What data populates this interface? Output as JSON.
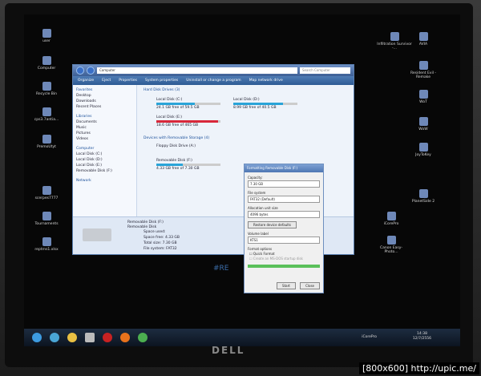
{
  "brand": "DELL",
  "watermark": "[800x600] http://upic.me/",
  "desktop": {
    "left_icons": [
      "user",
      "Computer",
      "Recycle Bin",
      "cps3.7antia...",
      "PremoUtyt",
      "scerpes7777",
      "Tournaments",
      "reptrns1.xlsx"
    ],
    "right_icons": [
      "Infiltration Survivor -...",
      "AVIA",
      "Resident Evil - Remake",
      "WoT",
      "WoW",
      "JoyToKey",
      "PlanetSide 2",
      "share",
      "iCorePro",
      "Data",
      "Canon Easy-Photo..."
    ],
    "overlay_text": "#RE"
  },
  "explorer": {
    "address": "Computer",
    "search_placeholder": "Search Computer",
    "toolbar": [
      "Organize",
      "Eject",
      "Properties",
      "System properties",
      "Uninstall or change a program",
      "Map network drive"
    ],
    "nav": {
      "favorites": "Favorites",
      "fav_items": [
        "Desktop",
        "Downloads",
        "Recent Places"
      ],
      "libraries": "Libraries",
      "lib_items": [
        "Documents",
        "Music",
        "Pictures",
        "Videos"
      ],
      "computer": "Computer",
      "comp_items": [
        "Local Disk (C:)",
        "Local Disk (D:)",
        "Local Disk (E:)",
        "Removable Disk (F:)"
      ],
      "network": "Network"
    },
    "groups": [
      "Hard Disk Drives (3)",
      "Devices with Removable Storage (4)"
    ],
    "drives": [
      {
        "name": "Local Disk (C:)",
        "free": "24.1 GB free of 59.5 GB",
        "used_fraction": 0.6
      },
      {
        "name": "Local Disk (D:)",
        "free": "8.99 GB free of 40.5 GB",
        "used_fraction": 0.78
      },
      {
        "name": "Local Disk (E:)",
        "free": "18.6 GB free of 465 GB",
        "used_fraction": 0.96
      },
      {
        "name": "Floppy Disk Drive (A:)",
        "free": "",
        "used_fraction": 0
      },
      {
        "name": "Removable Disk (F:)",
        "free": "4.33 GB free of 7.30 GB",
        "used_fraction": 0.41
      }
    ],
    "details": {
      "title": "Removable Disk (F:)",
      "type": "Removable Disk",
      "space_used": "Space used:",
      "space_free": "Space free: 4.33 GB",
      "total_size": "Total size: 7.30 GB",
      "file_system": "File system: FAT32"
    }
  },
  "format_dialog": {
    "title": "Formatting Removable Disk (F:)",
    "capacity_label": "Capacity:",
    "capacity": "7.30 GB",
    "fs_label": "File system",
    "fs": "FAT32 (Default)",
    "alloc_label": "Allocation unit size",
    "alloc": "4096 bytes",
    "restore": "Restore device defaults",
    "volume_label": "Volume label",
    "volume": "KTS1",
    "options_label": "Format options",
    "quick": "Quick Format",
    "msdos": "Create an MS-DOS startup disk",
    "start": "Start",
    "close": "Close"
  },
  "taskbar": {
    "tray_app": "iCorePro",
    "time": "14:38",
    "date": "12/7/2556"
  }
}
